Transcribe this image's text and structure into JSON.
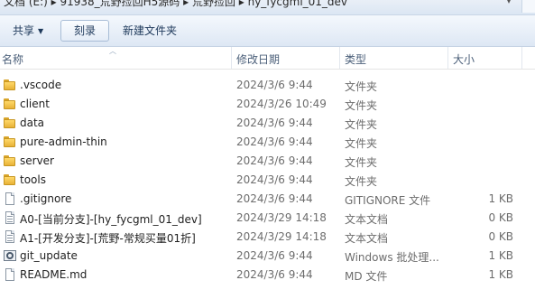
{
  "address_bar": {
    "path_text": "文档 (E:) ▸ 91938_荒野捡回H5源码 ▸ 荒野捡回 ▸ hy_fycgml_01_dev",
    "dropdown_icon": "chevron-down-icon"
  },
  "toolbar": {
    "share_label": "共享",
    "burn_label": "刻录",
    "new_folder_label": "新建文件夹"
  },
  "columns": {
    "name": "名称",
    "modified": "修改日期",
    "type": "类型",
    "size": "大小"
  },
  "files": [
    {
      "name": ".vscode",
      "modified": "2024/3/6 9:44",
      "type": "文件夹",
      "size": "",
      "icon": "folder-icon"
    },
    {
      "name": "client",
      "modified": "2024/3/26 10:49",
      "type": "文件夹",
      "size": "",
      "icon": "folder-icon"
    },
    {
      "name": "data",
      "modified": "2024/3/6 9:44",
      "type": "文件夹",
      "size": "",
      "icon": "folder-icon"
    },
    {
      "name": "pure-admin-thin",
      "modified": "2024/3/6 9:44",
      "type": "文件夹",
      "size": "",
      "icon": "folder-icon"
    },
    {
      "name": "server",
      "modified": "2024/3/6 9:44",
      "type": "文件夹",
      "size": "",
      "icon": "folder-icon"
    },
    {
      "name": "tools",
      "modified": "2024/3/6 9:44",
      "type": "文件夹",
      "size": "",
      "icon": "folder-icon"
    },
    {
      "name": ".gitignore",
      "modified": "2024/3/6 9:44",
      "type": "GITIGNORE 文件",
      "size": "1 KB",
      "icon": "file-icon"
    },
    {
      "name": "A0-[当前分支]-[hy_fycgml_01_dev]",
      "modified": "2024/3/29 14:18",
      "type": "文本文档",
      "size": "0 KB",
      "icon": "text-file-icon"
    },
    {
      "name": "A1-[开发分支]-[荒野-常规买量01折]",
      "modified": "2024/3/29 14:18",
      "type": "文本文档",
      "size": "0 KB",
      "icon": "text-file-icon"
    },
    {
      "name": "git_update",
      "modified": "2024/3/6 9:44",
      "type": "Windows 批处理...",
      "size": "1 KB",
      "icon": "batch-file-icon"
    },
    {
      "name": "README.md",
      "modified": "2024/3/6 9:44",
      "type": "MD 文件",
      "size": "1 KB",
      "icon": "file-icon"
    }
  ]
}
